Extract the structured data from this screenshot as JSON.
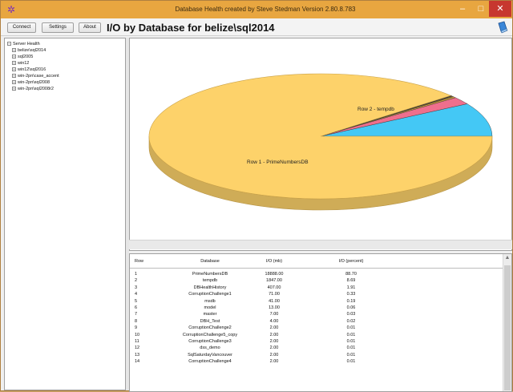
{
  "window": {
    "title": "Database Health created by Steve Stedman Version 2.80.8.783",
    "min_glyph": "–",
    "max_glyph": "□",
    "close_glyph": "✕",
    "app_icon": "gear-icon"
  },
  "toolbar": {
    "connect_label": "Connect",
    "settings_label": "Settings",
    "about_label": "About",
    "page_title": "I/O by Database for belize\\sql2014",
    "help_icon": "help-book-icon"
  },
  "tree": {
    "root": "Server Health",
    "root_expander": "−",
    "child_expander": "+",
    "children": [
      "belize\\sql2014",
      "sql2005",
      "win12",
      "win12\\sql2016",
      "win-2pn\\case_accent",
      "win-2pn\\sql2008",
      "win-2pn\\sql2008r2"
    ]
  },
  "chart_data": {
    "type": "pie",
    "labels_shown": [
      "Row 1 - PrimeNumbersDB",
      "Row 2 - tempdb"
    ],
    "categories": [
      "PrimeNumbersDB",
      "tempdb",
      "DBHealthHistory",
      "CorruptionChallenge1",
      "msdb",
      "model",
      "master",
      "DBH_Test",
      "CorruptionChallenge2",
      "CorruptionChallenge5_copy",
      "CorruptionChallenge3",
      "dss_demo",
      "SqlSaturdayVancouver"
    ],
    "values": [
      88.7,
      8.69,
      1.91,
      0.33,
      0.19,
      0.06,
      0.03,
      0.02,
      0.01,
      0.01,
      0.01,
      0.01,
      0.01
    ],
    "colors": [
      "#fdd26a",
      "#44c8f5",
      "#ef6f8d",
      "#c89a3a",
      "#8a6d2f",
      "#3b3b3b",
      "#e6a94b",
      "#5a5a5a",
      "#999999",
      "#777777",
      "#555555",
      "#aaaaaa",
      "#666666"
    ],
    "legend": "none"
  },
  "grid": {
    "columns": [
      "Row",
      "Database",
      "I/O (mb)",
      "I/O (percent)"
    ],
    "rows": [
      [
        "1",
        "PrimeNumbersDB",
        "18888.00",
        "88.70"
      ],
      [
        "2",
        "tempdb",
        "1847.00",
        "8.69"
      ],
      [
        "3",
        "DBHealthHistory",
        "407.00",
        "1.91"
      ],
      [
        "4",
        "CorruptionChallenge1",
        "71.00",
        "0.33"
      ],
      [
        "5",
        "msdb",
        "41.00",
        "0.19"
      ],
      [
        "6",
        "model",
        "13.00",
        "0.06"
      ],
      [
        "7",
        "master",
        "7.00",
        "0.03"
      ],
      [
        "8",
        "DBH_Test",
        "4.00",
        "0.02"
      ],
      [
        "9",
        "CorruptionChallenge2",
        "2.00",
        "0.01"
      ],
      [
        "10",
        "CorruptionChallenge5_copy",
        "2.00",
        "0.01"
      ],
      [
        "11",
        "CorruptionChallenge3",
        "2.00",
        "0.01"
      ],
      [
        "12",
        "dss_demo",
        "2.00",
        "0.01"
      ],
      [
        "13",
        "SqlSaturdayVancouver",
        "2.00",
        "0.01"
      ],
      [
        "14",
        "CorruptionChallenge4",
        "2.00",
        "0.01"
      ]
    ],
    "scroll_up_glyph": "▲"
  }
}
